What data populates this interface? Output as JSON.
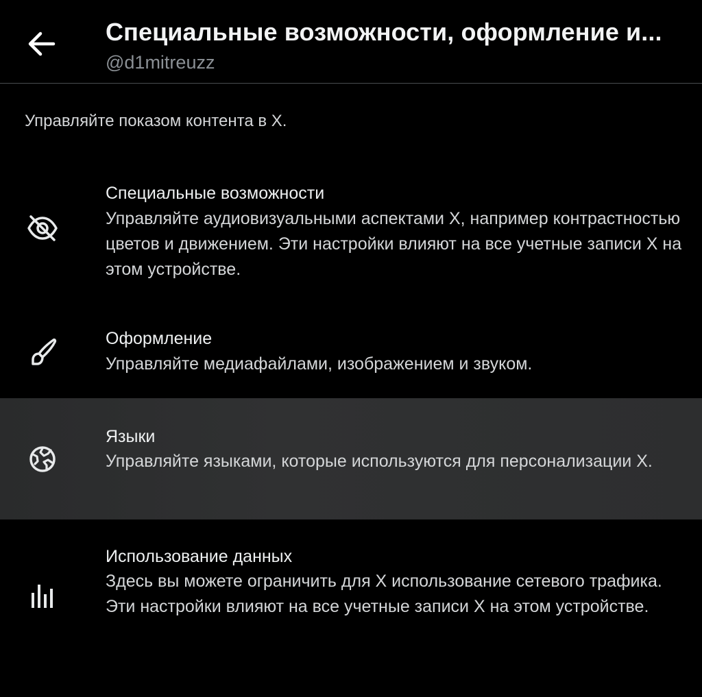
{
  "header": {
    "title": "Специальные возможности, оформление и...",
    "subtitle": "@d1mitreuzz",
    "back_icon": "arrow-left-icon"
  },
  "intro": "Управляйте показом контента в X.",
  "items": [
    {
      "icon": "eye-slash-icon",
      "title": "Специальные возможности",
      "description": "Управляйте аудиовизуальными аспектами X, например контрастностью цветов и движением. Эти настройки влияют на все учетные записи X на этом устройстве."
    },
    {
      "icon": "paintbrush-icon",
      "title": "Оформление",
      "description": "Управляйте медиафайлами, изображением и звуком."
    },
    {
      "icon": "globe-icon",
      "title": "Языки",
      "description": "Управляйте языками, которые используются для персонализации X.",
      "selected": true
    },
    {
      "icon": "bar-chart-icon",
      "title": "Использование данных",
      "description": "Здесь вы можете ограничить для X использование сетевого трафика. Эти настройки влияют на все учетные записи X на этом устройстве."
    }
  ],
  "colors": {
    "background": "#000000",
    "text_primary": "#eef0f1",
    "text_secondary": "#8b9095",
    "selected_row": "#2e2f30",
    "divider": "#4a4d50"
  }
}
